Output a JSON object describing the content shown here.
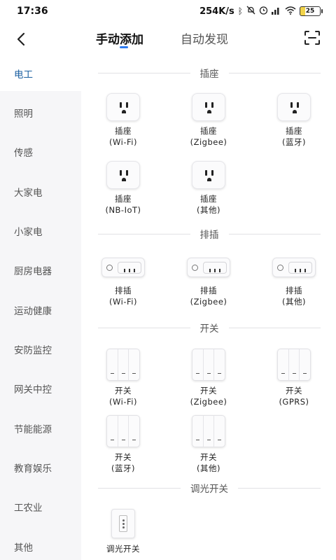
{
  "status_bar": {
    "time": "17:36",
    "net_speed": "254K/s",
    "battery": "25"
  },
  "header": {
    "tab_manual": "手动添加",
    "tab_auto": "自动发现"
  },
  "sidebar": {
    "items": [
      {
        "label": "电工",
        "active": true
      },
      {
        "label": "照明"
      },
      {
        "label": "传感"
      },
      {
        "label": "大家电"
      },
      {
        "label": "小家电"
      },
      {
        "label": "厨房电器"
      },
      {
        "label": "运动健康"
      },
      {
        "label": "安防监控"
      },
      {
        "label": "网关中控"
      },
      {
        "label": "节能能源"
      },
      {
        "label": "教育娱乐"
      },
      {
        "label": "工农业"
      },
      {
        "label": "其他"
      }
    ]
  },
  "sections": {
    "socket": {
      "title": "插座",
      "devices": [
        {
          "name": "插座",
          "variant": "(Wi-Fi)",
          "icon": "socket-icon"
        },
        {
          "name": "插座",
          "variant": "(Zigbee)",
          "icon": "socket-icon"
        },
        {
          "name": "插座",
          "variant": "(蓝牙)",
          "icon": "socket-icon"
        },
        {
          "name": "插座",
          "variant": "(NB-IoT)",
          "icon": "socket-icon"
        },
        {
          "name": "插座",
          "variant": "(其他)",
          "icon": "socket-icon"
        }
      ]
    },
    "power_strip": {
      "title": "排插",
      "devices": [
        {
          "name": "排插",
          "variant": "(Wi-Fi)",
          "icon": "power-strip-icon"
        },
        {
          "name": "排插",
          "variant": "(Zigbee)",
          "icon": "power-strip-icon"
        },
        {
          "name": "排插",
          "variant": "(其他)",
          "icon": "power-strip-icon"
        }
      ]
    },
    "switch": {
      "title": "开关",
      "devices": [
        {
          "name": "开关",
          "variant": "(Wi-Fi)",
          "icon": "wall-switch-icon"
        },
        {
          "name": "开关",
          "variant": "(Zigbee)",
          "icon": "wall-switch-icon"
        },
        {
          "name": "开关",
          "variant": "(GPRS)",
          "icon": "wall-switch-icon"
        },
        {
          "name": "开关",
          "variant": "(蓝牙)",
          "icon": "wall-switch-icon"
        },
        {
          "name": "开关",
          "variant": "(其他)",
          "icon": "wall-switch-icon"
        }
      ]
    },
    "dimmer": {
      "title": "调光开关",
      "devices": [
        {
          "name": "调光开关",
          "icon": "dimmer-switch-icon"
        }
      ]
    }
  },
  "colors": {
    "accent": "#2e7bf0",
    "sidebar_bg": "#f6f6f8",
    "sidebar_active_text": "#1a5fa0"
  }
}
